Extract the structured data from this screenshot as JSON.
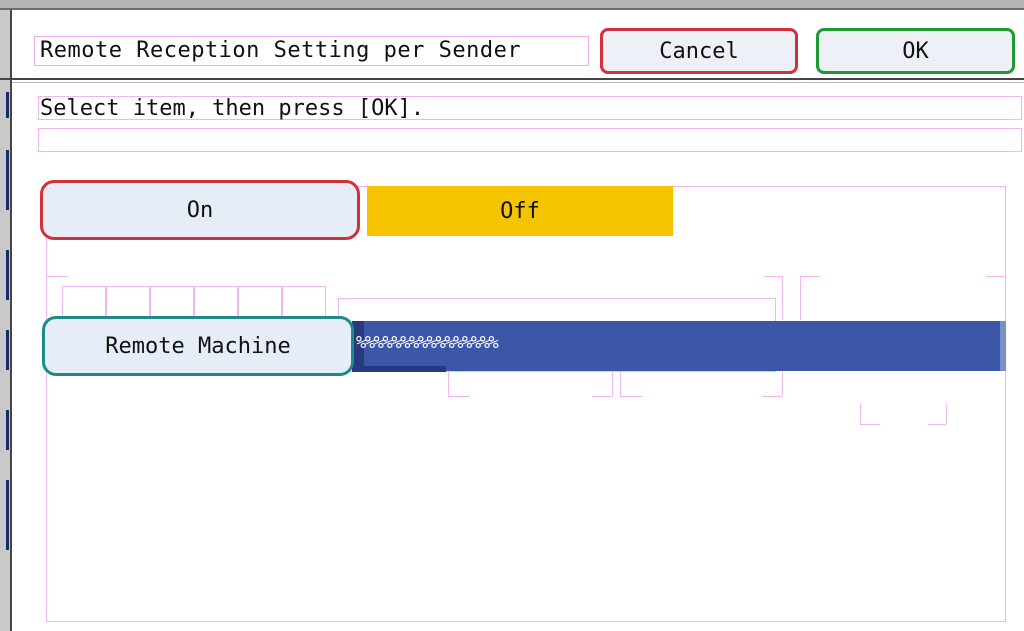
{
  "header": {
    "title": "Remote Reception Setting per Sender",
    "cancel_label": "Cancel",
    "ok_label": "OK"
  },
  "message": "Select item, then press [OK].",
  "toggle": {
    "on_label": "On",
    "off_label": "Off",
    "selected": "Off"
  },
  "remote_machine": {
    "button_label": "Remote Machine",
    "value": "%%%%%%%%%%%%%%%%"
  },
  "colors": {
    "selected_highlight": "#f6c300",
    "field_background": "#3c57a7",
    "cancel_border": "#d1303d",
    "ok_border": "#1e9a30",
    "remote_border": "#1f8a8a"
  }
}
